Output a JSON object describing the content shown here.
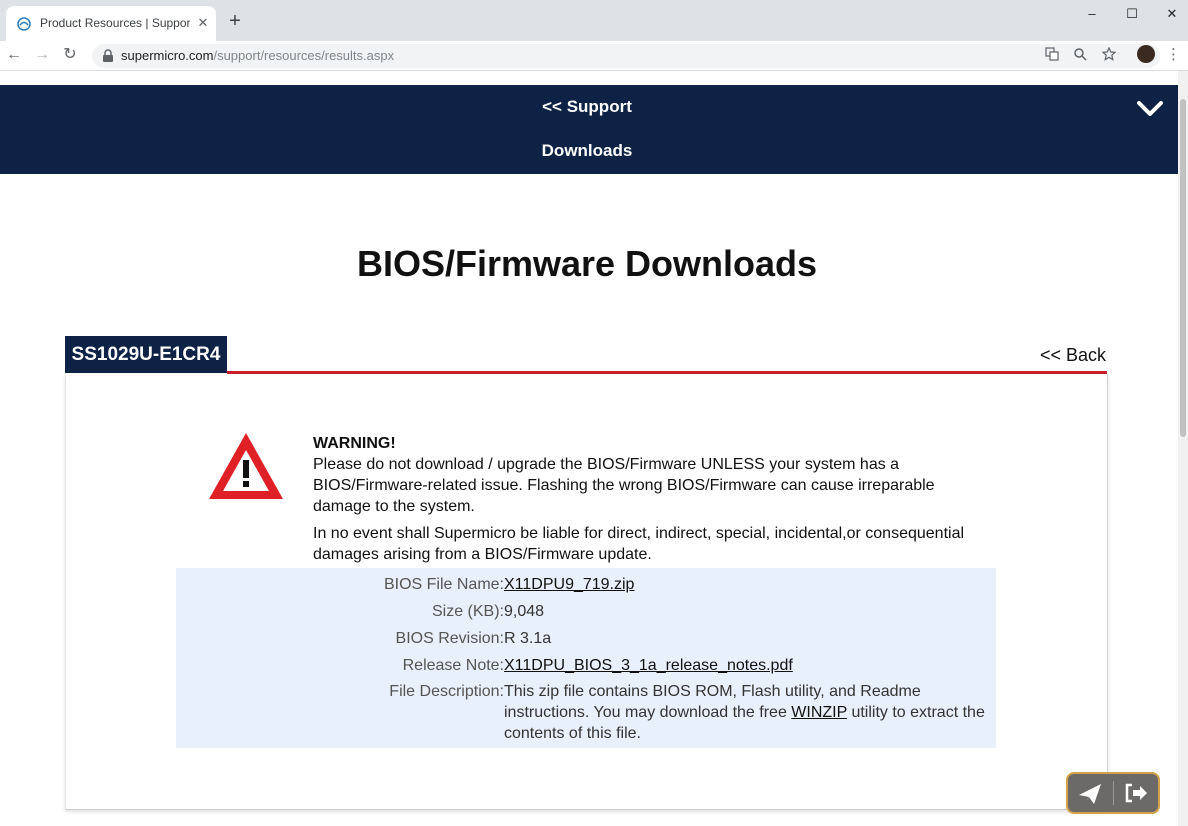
{
  "browser": {
    "tab_title": "Product Resources | Support - Su",
    "tab_close": "✕",
    "new_tab": "+",
    "url_host": "supermicro.com",
    "url_path": "/support/resources/results.aspx",
    "window_controls": {
      "minimize": "–",
      "maximize": "☐",
      "close": "✕"
    },
    "nav": {
      "back": "←",
      "forward": "→",
      "reload": "↻"
    },
    "icons": [
      "lock-icon",
      "translate-icon",
      "zoom-icon",
      "star-icon",
      "avatar",
      "menu-icon"
    ]
  },
  "site_nav": {
    "support_label": "<< Support",
    "downloads_label": "Downloads"
  },
  "page": {
    "title": "BIOS/Firmware Downloads",
    "model": "SS1029U-E1CR4",
    "back_label": "<< Back"
  },
  "warning": {
    "title": "WARNING!",
    "paragraph1": "Please do not download / upgrade the BIOS/Firmware UNLESS your system has a BIOS/Firmware-related issue. Flashing the wrong BIOS/Firmware can cause irreparable damage to the system.",
    "paragraph2": "In no event shall Supermicro be liable for direct, indirect, special, incidental,or consequential damages arising from a BIOS/Firmware update."
  },
  "details": {
    "file_name_label": "BIOS File Name:",
    "file_name": "X11DPU9_719.zip",
    "size_label": "Size (KB):",
    "size": "9,048",
    "revision_label": "BIOS Revision:",
    "revision": "R 3.1a",
    "release_note_label": "Release Note:",
    "release_note": "X11DPU_BIOS_3_1a_release_notes.pdf",
    "description_label": "File Description:",
    "description_before": "This zip file contains BIOS ROM, Flash utility, and Readme instructions. You may download the free ",
    "description_link": "WINZIP",
    "description_after": " utility to extract the contents of this file."
  },
  "colors": {
    "navy": "#0d2245",
    "red_rule": "#c8202f",
    "details_bg": "#e8f0fb",
    "warning_red": "#e02027"
  }
}
